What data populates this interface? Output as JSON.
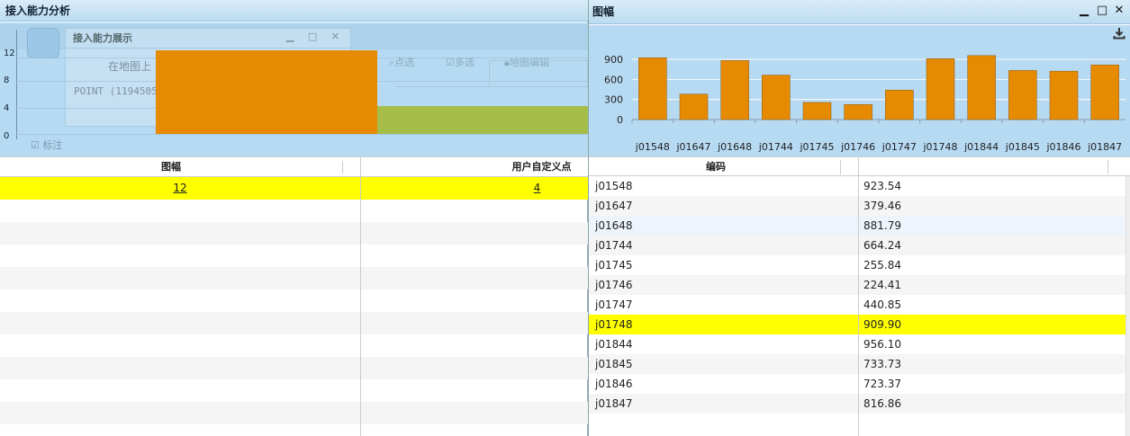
{
  "left_window": {
    "title": "接入能力分析",
    "ghost_subwindow_title": "接入能力展示",
    "ghost_text_map": "在地图上",
    "ghost_text_point": "POINT (11945059",
    "ghost_tool_point": "点选",
    "ghost_tool_multi": "多选",
    "ghost_tool_edit": "地图编辑",
    "ghost_label": "标注",
    "y_ticks": [
      "12",
      "8",
      "4",
      "0"
    ],
    "colors": {
      "orange": "#e68a00",
      "green": "#a6bd4a"
    },
    "mini_chart": {
      "categories": [
        "图幅",
        "用户自定义点"
      ],
      "values": [
        12,
        4
      ]
    },
    "table": {
      "columns": [
        "图幅",
        "用户自定义点"
      ],
      "rows": [
        {
          "a": "12",
          "b": "4"
        }
      ]
    }
  },
  "right_window": {
    "title": "图幅",
    "controls": {
      "minimize": "▁",
      "maximize": "□",
      "close": "✕"
    },
    "chart_data": {
      "type": "bar",
      "categories": [
        "j01548",
        "j01647",
        "j01648",
        "j01744",
        "j01745",
        "j01746",
        "j01747",
        "j01748",
        "j01844",
        "j01845",
        "j01846",
        "j01847"
      ],
      "values": [
        923.54,
        379.46,
        881.79,
        664.24,
        255.84,
        224.41,
        440.85,
        909.9,
        956.1,
        733.73,
        723.37,
        816.86
      ],
      "yticks": [
        "0",
        "300",
        "600",
        "900"
      ],
      "ylim": [
        0,
        1100
      ],
      "bar_color": "#e68a00",
      "grid": true
    },
    "table": {
      "columns": [
        "编码",
        ""
      ],
      "rows": [
        {
          "code": "j01548",
          "value": "923.54"
        },
        {
          "code": "j01647",
          "value": "379.46"
        },
        {
          "code": "j01648",
          "value": "881.79"
        },
        {
          "code": "j01744",
          "value": "664.24"
        },
        {
          "code": "j01745",
          "value": "255.84"
        },
        {
          "code": "j01746",
          "value": "224.41"
        },
        {
          "code": "j01747",
          "value": "440.85"
        },
        {
          "code": "j01748",
          "value": "909.90"
        },
        {
          "code": "j01844",
          "value": "956.10"
        },
        {
          "code": "j01845",
          "value": "733.73"
        },
        {
          "code": "j01846",
          "value": "723.37"
        },
        {
          "code": "j01847",
          "value": "816.86"
        }
      ],
      "selected_row": 7
    }
  }
}
